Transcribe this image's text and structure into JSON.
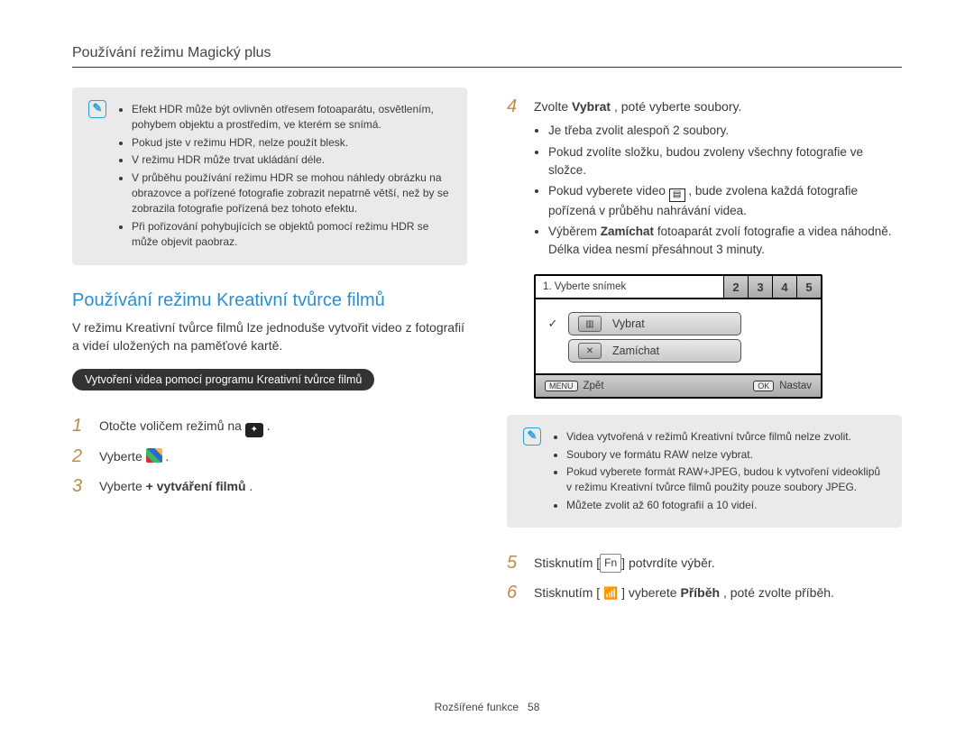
{
  "header": "Používání režimu Magický plus",
  "left": {
    "note": {
      "icon": "note-icon",
      "bullets": [
        "Efekt HDR může být ovlivněn otřesem fotoaparátu, osvětlením, pohybem objektu a prostředím, ve kterém se snímá.",
        "Pokud jste v režimu HDR, nelze použít blesk.",
        "V režimu HDR může trvat ukládání déle.",
        "V průběhu používání režimu HDR se mohou náhledy obrázku na obrazovce a pořízené fotografie zobrazit nepatrně větší, než by se zobrazila fotografie pořízená bez tohoto efektu.",
        "Při pořizování pohybujících se objektů pomocí režimu HDR se může objevit paobraz."
      ]
    },
    "section_title": "Používání režimu Kreativní tvůrce filmů",
    "section_desc": "V režimu Kreativní tvůrce filmů lze jednoduše vytvořit video z fotografií a videí uložených na paměťové kartě.",
    "pill": "Vytvoření videa pomocí programu Kreativní tvůrce filmů",
    "step1": {
      "num": "1",
      "pre": "Otočte voličem režimů na ",
      "post": " ."
    },
    "step2": {
      "num": "2",
      "pre": "Vyberte ",
      "post": " ."
    },
    "step3": {
      "num": "3",
      "pre": "Vyberte ",
      "bold": "+ vytváření filmů",
      "post": "."
    }
  },
  "right": {
    "step4": {
      "num": "4",
      "pre": "Zvolte ",
      "bold": "Vybrat",
      "post": ", poté vyberte soubory.",
      "bullets": {
        "b1": "Je třeba zvolit alespoň 2 soubory.",
        "b2": "Pokud zvolíte složku, budou zvoleny všechny fotografie ve složce.",
        "b3_pre": "Pokud vyberete video ",
        "b3_post": ", bude zvolena každá fotografie pořízená v průběhu nahrávání videa.",
        "b4_pre": "Výběrem ",
        "b4_bold": "Zamíchat",
        "b4_post": " fotoaparát zvolí fotografie a videa náhodně. Délka videa nesmí přesáhnout 3 minuty."
      }
    },
    "lcd": {
      "tab0": "1. Vyberte snímek",
      "tabs": [
        "2",
        "3",
        "4",
        "5"
      ],
      "row1": {
        "check": "✓",
        "label": "Vybrat"
      },
      "row2": {
        "label": "Zamíchat"
      },
      "foot_left_btn": "MENU",
      "foot_left": "Zpět",
      "foot_right_btn": "OK",
      "foot_right": "Nastav"
    },
    "note": {
      "icon": "note-icon",
      "bullets": [
        "Videa vytvořená v režimů Kreativní tvůrce filmů nelze zvolit.",
        "Soubory ve formátu RAW nelze vybrat.",
        "Pokud vyberete formát RAW+JPEG, budou k vytvoření videoklipů v režimu Kreativní tvůrce filmů použity pouze soubory JPEG.",
        "Můžete zvolit až 60 fotografií a 10 videí."
      ]
    },
    "step5": {
      "num": "5",
      "pre": "Stisknutím ",
      "key": "Fn",
      "post": " potvrdíte výběr."
    },
    "step6": {
      "num": "6",
      "pre": "Stisknutím [",
      "post1": "] vyberete ",
      "bold": "Příběh",
      "post2": ", poté zvolte příběh."
    }
  },
  "footer": {
    "label": "Rozšířené funkce",
    "page": "58"
  }
}
